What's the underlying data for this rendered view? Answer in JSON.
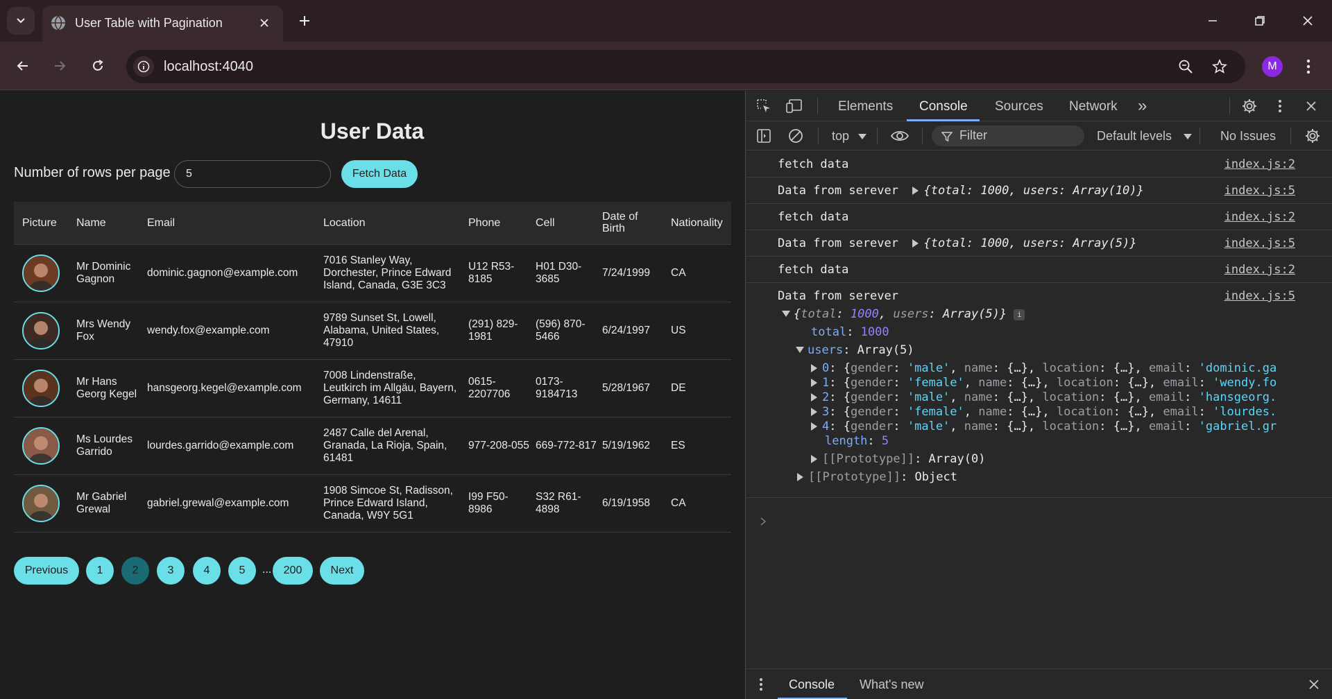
{
  "browser": {
    "tab_title": "User Table with Pagination",
    "url": "localhost:4040",
    "profile_initial": "M"
  },
  "page": {
    "title": "User Data",
    "rows_label": "Number of rows per page",
    "rows_value": "5",
    "fetch_label": "Fetch Data",
    "columns": [
      "Picture",
      "Name",
      "Email",
      "Location",
      "Phone",
      "Cell",
      "Date of Birth",
      "Nationality"
    ],
    "rows": [
      {
        "name": "Mr Dominic Gagnon",
        "email": "dominic.gagnon@example.com",
        "location": "7016 Stanley Way, Dorchester, Prince Edward Island, Canada, G3E 3C3",
        "phone": "U12 R53-8185",
        "cell": "H01 D30-3685",
        "dob": "7/24/1999",
        "nat": "CA",
        "avatar_color": "#6b3b24"
      },
      {
        "name": "Mrs Wendy Fox",
        "email": "wendy.fox@example.com",
        "location": "9789 Sunset St, Lowell, Alabama, United States, 47910",
        "phone": "(291) 829-1981",
        "cell": "(596) 870-5466",
        "dob": "6/24/1997",
        "nat": "US",
        "avatar_color": "#3d2a24"
      },
      {
        "name": "Mr Hans Georg Kegel",
        "email": "hansgeorg.kegel@example.com",
        "location": "7008 Lindenstraße, Leutkirch im Allgäu, Bayern, Germany, 14611",
        "phone": "0615-2207706",
        "cell": "0173-9184713",
        "dob": "5/28/1967",
        "nat": "DE",
        "avatar_color": "#5a3420"
      },
      {
        "name": "Ms Lourdes Garrido",
        "email": "lourdes.garrido@example.com",
        "location": "2487 Calle del Arenal, Granada, La Rioja, Spain, 61481",
        "phone": "977-208-055",
        "cell": "669-772-817",
        "dob": "5/19/1962",
        "nat": "ES",
        "avatar_color": "#8a5a48"
      },
      {
        "name": "Mr Gabriel Grewal",
        "email": "gabriel.grewal@example.com",
        "location": "1908 Simcoe St, Radisson, Prince Edward Island, Canada, W9Y 5G1",
        "phone": "I99 F50-8986",
        "cell": "S32 R61-4898",
        "dob": "6/19/1958",
        "nat": "CA",
        "avatar_color": "#6f5a40"
      }
    ],
    "pagination": {
      "previous": "Previous",
      "pages": [
        "1",
        "2",
        "3",
        "4",
        "5"
      ],
      "active_page": "2",
      "ellipsis": "...",
      "last": "200",
      "next": "Next"
    }
  },
  "devtools": {
    "tabs": [
      "Elements",
      "Console",
      "Sources",
      "Network"
    ],
    "active_tab": "Console",
    "more": "»",
    "context": "top",
    "filter_placeholder": "Filter",
    "levels": "Default levels",
    "issues": "No Issues",
    "logs": [
      {
        "msg": "fetch data",
        "src": "index.js:2"
      },
      {
        "msg": "Data from serever",
        "preview": "{total: 1000, users: Array(10)}",
        "src": "index.js:5"
      },
      {
        "msg": "fetch data",
        "src": "index.js:2"
      },
      {
        "msg": "Data from serever",
        "preview": "{total: 1000, users: Array(5)}",
        "src": "index.js:5"
      },
      {
        "msg": "fetch data",
        "src": "index.js:2"
      },
      {
        "msg": "Data from serever",
        "src": "index.js:5"
      }
    ],
    "expanded": {
      "summary_total": "1000",
      "summary_users": "Array(5)",
      "total_key": "total",
      "total_val": "1000",
      "users_key": "users",
      "users_val": "Array(5)",
      "items": [
        {
          "idx": "0",
          "gender": "'male'",
          "email": "'dominic.ga"
        },
        {
          "idx": "1",
          "gender": "'female'",
          "email": "'wendy.fo"
        },
        {
          "idx": "2",
          "gender": "'male'",
          "email": "'hansgeorg."
        },
        {
          "idx": "3",
          "gender": "'female'",
          "email": "'lourdes."
        },
        {
          "idx": "4",
          "gender": "'male'",
          "email": "'gabriel.gr"
        }
      ],
      "length_key": "length",
      "length_val": "5",
      "proto_array": "Array(0)",
      "proto_object": "Object",
      "proto_key": "[[Prototype]]"
    },
    "drawer_tabs": [
      "Console",
      "What's new"
    ]
  }
}
